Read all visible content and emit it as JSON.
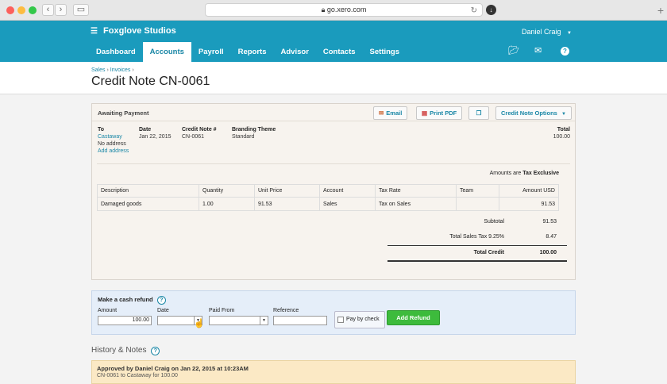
{
  "browser": {
    "url": "go.xero.com",
    "reload_icon": "↻",
    "download_icon": "↓",
    "new_tab_icon": "+"
  },
  "header": {
    "org_name": "Foxglove Studios",
    "user_name": "Daniel Craig",
    "tabs": [
      "Dashboard",
      "Accounts",
      "Payroll",
      "Reports",
      "Advisor",
      "Contacts",
      "Settings"
    ],
    "active_tab": "Accounts",
    "brand_color": "#1a9bbd"
  },
  "breadcrumb": {
    "items": [
      "Sales",
      "Invoices"
    ]
  },
  "page_title": "Credit Note CN-0061",
  "credit_note": {
    "status": "Awaiting Payment",
    "buttons": {
      "email": "Email",
      "print_pdf": "Print PDF",
      "options": "Credit Note Options"
    },
    "to_label": "To",
    "to_name": "Castaway",
    "to_address": "No address",
    "add_address": "Add address",
    "date_label": "Date",
    "date_value": "Jan 22, 2015",
    "number_label": "Credit Note #",
    "number_value": "CN-0061",
    "theme_label": "Branding Theme",
    "theme_value": "Standard",
    "total_label": "Total",
    "total_value": "100.00",
    "amounts_are": "Amounts are",
    "tax_mode": "Tax Exclusive",
    "columns": [
      "Description",
      "Quantity",
      "Unit Price",
      "Account",
      "Tax Rate",
      "Team",
      "Amount USD"
    ],
    "rows": [
      {
        "description": "Damaged goods",
        "quantity": "1.00",
        "unit_price": "91.53",
        "account": "Sales",
        "tax_rate": "Tax on Sales",
        "team": "",
        "amount": "91.53"
      }
    ],
    "subtotal_label": "Subtotal",
    "subtotal_value": "91.53",
    "tax_label": "Total Sales Tax 9.25%",
    "tax_value": "8.47",
    "total_credit_label": "Total Credit",
    "total_credit_value": "100.00"
  },
  "refund": {
    "title": "Make a cash refund",
    "amount_label": "Amount",
    "amount_value": "100.00",
    "date_label": "Date",
    "date_value": "",
    "paid_from_label": "Paid From",
    "paid_from_value": "",
    "reference_label": "Reference",
    "reference_value": "",
    "pay_by_check_label": "Pay by check",
    "add_button": "Add Refund"
  },
  "history": {
    "title": "History & Notes",
    "entry_line": "Approved by Daniel Craig on Jan 22, 2015 at 10:23AM",
    "entry_sub": "CN-0061 to Castaway for 100.00"
  }
}
